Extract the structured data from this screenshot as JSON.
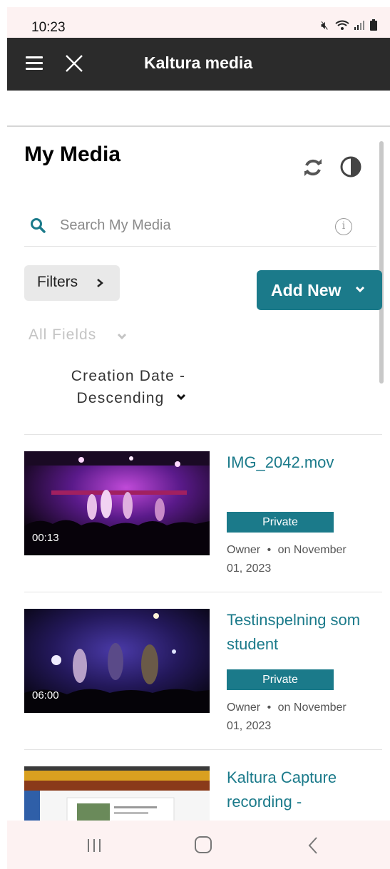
{
  "status_bar": {
    "time": "10:23",
    "icons": [
      "mute-icon",
      "wifi-icon",
      "signal-icon",
      "battery-icon"
    ]
  },
  "app_bar": {
    "title": "Kaltura media",
    "icons": [
      "menu-icon",
      "close-icon"
    ]
  },
  "page": {
    "title": "My Media",
    "search": {
      "placeholder": "Search My Media",
      "value": ""
    },
    "filters_label": "Filters",
    "add_new_label": "Add New",
    "fields_select": "All Fields",
    "sort_line1": "Creation Date -",
    "sort_line2": "Descending"
  },
  "media_items": [
    {
      "title": "IMG_2042.mov",
      "duration": "00:13",
      "status": "Private",
      "owner": "Owner",
      "date_line1": "on November",
      "date_line2": "01, 2023"
    },
    {
      "title": "Testinspelning som student",
      "duration": "06:00",
      "status": "Private",
      "owner": "Owner",
      "date_line1": "on November",
      "date_line2": "01, 2023"
    },
    {
      "title": "Kaltura Capture recording -",
      "duration": "",
      "status": "",
      "owner": "",
      "date_line1": "",
      "date_line2": ""
    }
  ],
  "colors": {
    "accent": "#1b7a8a",
    "app_bar": "#2b2b2b",
    "status_bar": "#fdf2f2"
  }
}
